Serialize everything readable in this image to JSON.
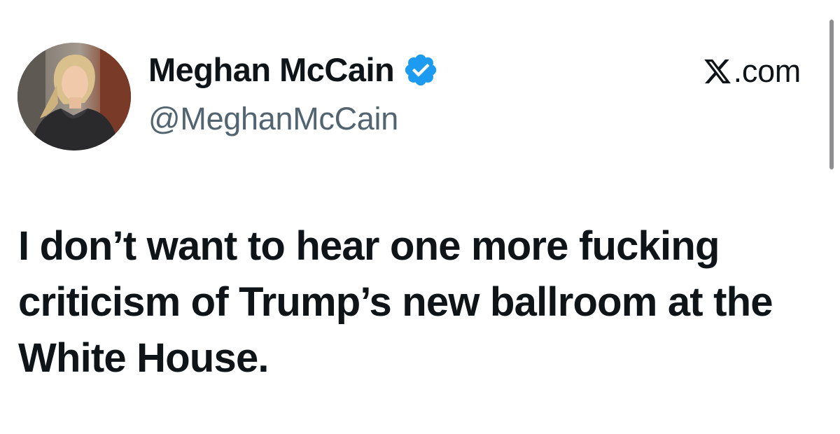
{
  "post": {
    "author": {
      "display_name": "Meghan McCain",
      "handle": "@MeghanMcCain",
      "verified": true,
      "verified_badge_color": "#1d9bf0",
      "avatar_icon": "profile-photo"
    },
    "source": {
      "logo_icon": "x-logo-icon",
      "text": ".com"
    },
    "text": "I don’t want to hear one more fucking criticism of Trump’s new ballroom at the White House."
  },
  "colors": {
    "text_primary": "#0f1419",
    "text_secondary": "#536471",
    "background": "#ffffff"
  }
}
